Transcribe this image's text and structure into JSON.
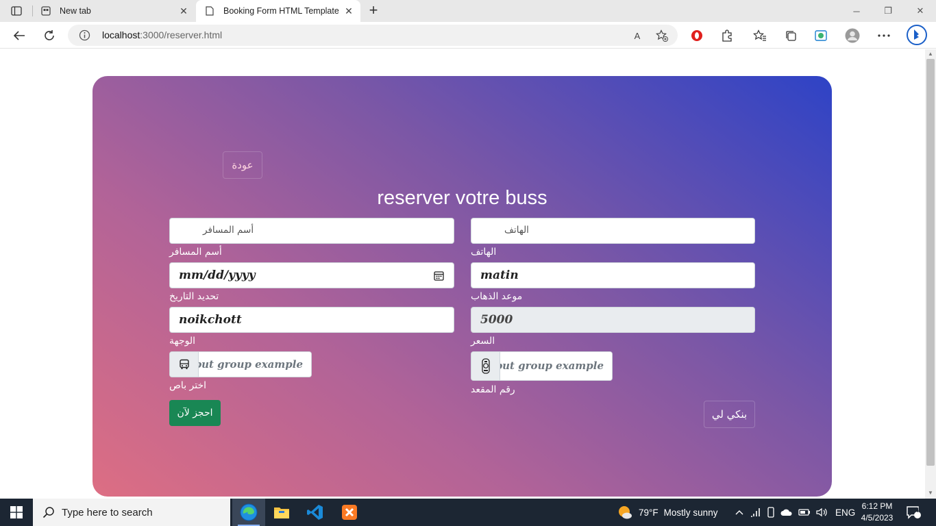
{
  "browser": {
    "tabs": [
      {
        "title": "New tab",
        "close": "✕"
      },
      {
        "title": "Booking Form HTML Template",
        "close": "✕"
      }
    ],
    "new_tab": "+",
    "url_host": "localhost",
    "url_path": ":3000/reserver.html",
    "read_aloud": "A",
    "window": {
      "minimize": "─",
      "restore": "❐",
      "close": "✕"
    }
  },
  "page": {
    "back_button": "عودة",
    "heading": "reserver votre buss",
    "fields": {
      "name_placeholder": "أسم المسافر",
      "name_label": "أسم المسافر",
      "phone_placeholder": "الهاتف",
      "phone_label": "الهاتف",
      "date_value": "mm/dd/yyyy",
      "date_label": "تحديد التاريخ",
      "time_value": "matin",
      "time_label": "موعد الذهاب",
      "destination_value": "noikchott",
      "destination_label": "الوجهة",
      "price_value": "5000",
      "price_label": "السعر",
      "bus_placeholder": "Input group example",
      "bus_label": "اختر باص",
      "seat_placeholder": "Input group example",
      "seat_label": "رقم المقعد"
    },
    "submit_button": "احجز لآن",
    "bankily_button": "بنكي لي"
  },
  "taskbar": {
    "search_text": "Type here to search",
    "weather_temp": "79°F",
    "weather_text": "Mostly sunny",
    "language": "ENG",
    "time": "6:12 PM",
    "date": "4/5/2023",
    "notifications": "4"
  },
  "colors": {
    "gradient": [
      "#dd6e83",
      "#b16398",
      "#7b57a6",
      "#2e43c6"
    ],
    "submit": "#198754",
    "taskbar": "#1c2633"
  }
}
